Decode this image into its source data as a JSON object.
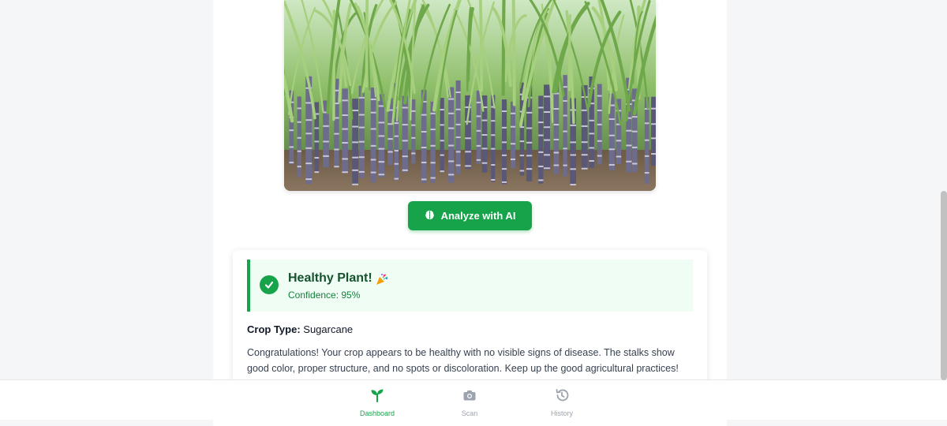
{
  "photo": {
    "alt": "Sugarcane field"
  },
  "analyze": {
    "label": "Analyze with AI",
    "icon": "brain-icon"
  },
  "result": {
    "status_title": "Healthy Plant!",
    "status_emoji": "party-popper-icon",
    "confidence": "Confidence: 95%",
    "crop_type_label": "Crop Type:",
    "crop_type_value": "Sugarcane",
    "description": "Congratulations! Your crop appears to be healthy with no visible signs of disease. The stalks show good color, proper structure, and no spots or discoloration. Keep up the good agricultural practices!"
  },
  "nav": {
    "items": [
      {
        "label": "Dashboard",
        "icon": "sprout-icon",
        "active": true
      },
      {
        "label": "Scan",
        "icon": "camera-icon",
        "active": false
      },
      {
        "label": "History",
        "icon": "history-icon",
        "active": false
      }
    ]
  },
  "colors": {
    "accent": "#16a34a",
    "banner_bg": "#f0fdf4",
    "nav_inactive": "#9ca3af"
  }
}
